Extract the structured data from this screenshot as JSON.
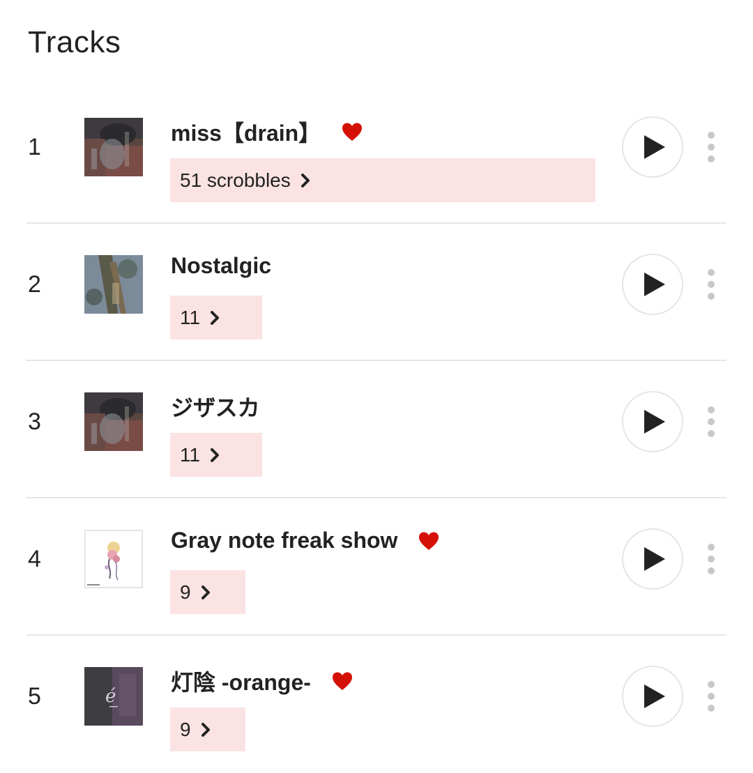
{
  "section": {
    "title": "Tracks"
  },
  "tracks": [
    {
      "rank": "1",
      "title": "miss【drain】",
      "loved": true,
      "scrobbles": "51 scrobbles",
      "bar_fill": 1.0
    },
    {
      "rank": "2",
      "title": "Nostalgic",
      "loved": false,
      "scrobbles": "11",
      "bar_fill": 0.216
    },
    {
      "rank": "3",
      "title": "ジザスカ",
      "loved": false,
      "scrobbles": "11",
      "bar_fill": 0.216
    },
    {
      "rank": "4",
      "title": "Gray note freak show",
      "loved": true,
      "scrobbles": "9",
      "bar_fill": 0.176
    },
    {
      "rank": "5",
      "title": "灯陰 -orange-",
      "loved": true,
      "scrobbles": "9",
      "bar_fill": 0.176
    }
  ],
  "icons": {
    "heart": "heart-icon",
    "chevron": "chevron-right-icon",
    "play": "play-icon",
    "more": "more-vertical-icon"
  },
  "colors": {
    "heart": "#d51007",
    "bar": "#fbe3e3",
    "text": "#222222",
    "divider": "#e6e6e6"
  }
}
